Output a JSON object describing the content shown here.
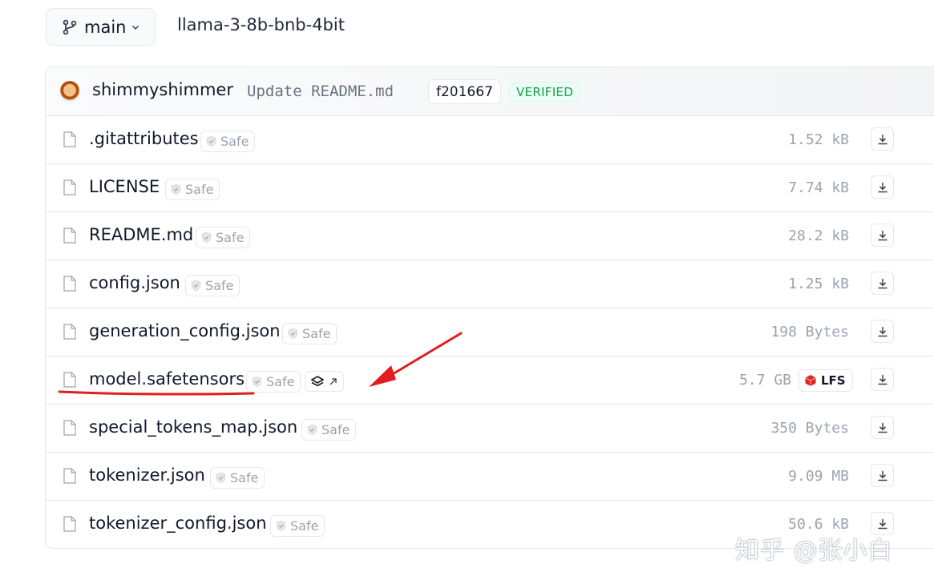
{
  "header": {
    "branch_label": "main",
    "repo_name": "llama-3-8b-bnb-4bit"
  },
  "commit": {
    "user": "shimmyshimmer",
    "message": "Update README.md",
    "hash": "f201667",
    "verified_label": "VERIFIED"
  },
  "files": [
    {
      "name": ".gitattributes",
      "safe": "Safe",
      "size": "1.52 kB"
    },
    {
      "name": "LICENSE",
      "safe": "Safe",
      "size": "7.74 kB"
    },
    {
      "name": "README.md",
      "safe": "Safe",
      "size": "28.2 kB"
    },
    {
      "name": "config.json",
      "safe": "Safe",
      "size": "1.25 kB"
    },
    {
      "name": "generation_config.json",
      "safe": "Safe",
      "size": "198 Bytes"
    },
    {
      "name": "model.safetensors",
      "safe": "Safe",
      "size": "5.7 GB",
      "lfs": "LFS"
    },
    {
      "name": "special_tokens_map.json",
      "safe": "Safe",
      "size": "350 Bytes"
    },
    {
      "name": "tokenizer.json",
      "safe": "Safe",
      "size": "9.09 MB"
    },
    {
      "name": "tokenizer_config.json",
      "safe": "Safe",
      "size": "50.6 kB"
    }
  ],
  "watermark": "知乎 @张小白",
  "colors": {
    "verified": "#16a34a",
    "annotation": "#e11d1d",
    "lfs_icon": "#dc2626"
  }
}
